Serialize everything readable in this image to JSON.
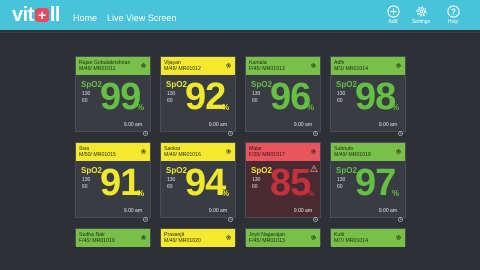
{
  "app": {
    "logo_left": "vit",
    "logo_plus": "+",
    "logo_right": "ll"
  },
  "nav": {
    "home": "Home",
    "live": "Live View Screen"
  },
  "toolbar": {
    "add_label": "Add",
    "settings_label": "Settings",
    "help_label": "Help"
  },
  "colors": {
    "header_bar": "#49c3da",
    "normal": "#65bf43",
    "warning": "#eee92b",
    "alarm": "#c5313b"
  },
  "patients": [
    {
      "name": "Rajan Gobalakrishnan",
      "meta": "M/49/ MR01011",
      "status": "green",
      "spo2_label": "SpO2",
      "hi": "130",
      "lo": "60",
      "value": "99",
      "unit": "%",
      "time": "9.00 am"
    },
    {
      "name": "Vijayan",
      "meta": "M/49/ MR01012",
      "status": "yellow",
      "spo2_label": "SpO2",
      "hi": "130",
      "lo": "60",
      "value": "92",
      "unit": "%",
      "time": "9.00 am"
    },
    {
      "name": "Kamala",
      "meta": "F/45/ MR01013",
      "status": "green",
      "spo2_label": "SpO2",
      "hi": "130",
      "lo": "60",
      "value": "96",
      "unit": "%",
      "time": "9.00 am"
    },
    {
      "name": "Adhi",
      "meta": "M/1/ MR01014",
      "status": "green",
      "spo2_label": "SpO2",
      "hi": "130",
      "lo": "60",
      "value": "98",
      "unit": "%",
      "time": "9.00 am"
    },
    {
      "name": "Siva",
      "meta": "M/50/ MR01015",
      "status": "yellow",
      "spo2_label": "SpO2",
      "hi": "130",
      "lo": "60",
      "value": "91",
      "unit": "%",
      "time": "9.00 am"
    },
    {
      "name": "Sankar",
      "meta": "M/49/ MR01016",
      "status": "yellow",
      "spo2_label": "SpO2",
      "hi": "130",
      "lo": "60",
      "value": "94",
      "unit": "%",
      "time": "9.00 am"
    },
    {
      "name": "Malar",
      "meta": "F/35/ MR01017",
      "status": "red",
      "spo2_label": "SpO2",
      "hi": "130",
      "lo": "60",
      "value": "85",
      "unit": "%",
      "time": "9.00 am"
    },
    {
      "name": "Subnuto",
      "meta": "M/49/ MR01018",
      "status": "green",
      "spo2_label": "SpO2",
      "hi": "130",
      "lo": "60",
      "value": "97",
      "unit": "%",
      "time": "9.00 am"
    },
    {
      "name": "Sudha Nair",
      "meta": "F/45/ MR01019",
      "status": "green"
    },
    {
      "name": "Prasanjit",
      "meta": "M/49/ MR01020",
      "status": "yellow"
    },
    {
      "name": "Joyti Nagarajan",
      "meta": "F/45/ MR01013",
      "status": "green"
    },
    {
      "name": "Kutti",
      "meta": "M/7/ MR01014",
      "status": "green"
    }
  ]
}
